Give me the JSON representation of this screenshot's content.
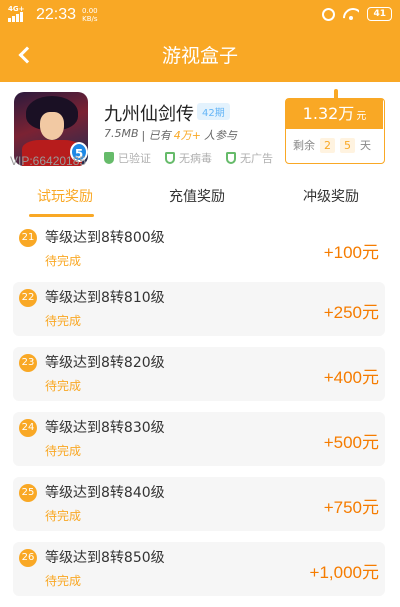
{
  "status_bar": {
    "network": "4G+",
    "time": "22:33",
    "speed_value": "0.00",
    "speed_unit": "KB/s",
    "battery": "41"
  },
  "nav": {
    "title": "游视盒子"
  },
  "game": {
    "name": "九州仙剑传",
    "period": "42期",
    "size": "7.5MB",
    "meta_sep": "| 已有",
    "players": "4万+",
    "players_suffix": "人参与",
    "vip": "VIP:66420185",
    "icon_badge": "5",
    "badges": [
      "已验证",
      "无病毒",
      "无广告"
    ]
  },
  "reward": {
    "amount": "1.32万",
    "unit": "元",
    "remain_label": "剩余",
    "days_tens": "2",
    "days_ones": "5",
    "days_unit": "天"
  },
  "tabs": [
    "试玩奖励",
    "充值奖励",
    "冲级奖励"
  ],
  "tasks": [
    {
      "num": "21",
      "title": "等级达到8转800级",
      "status": "待完成",
      "reward": "+100元"
    },
    {
      "num": "22",
      "title": "等级达到8转810级",
      "status": "待完成",
      "reward": "+250元"
    },
    {
      "num": "23",
      "title": "等级达到8转820级",
      "status": "待完成",
      "reward": "+400元"
    },
    {
      "num": "24",
      "title": "等级达到8转830级",
      "status": "待完成",
      "reward": "+500元"
    },
    {
      "num": "25",
      "title": "等级达到8转840级",
      "status": "待完成",
      "reward": "+750元"
    },
    {
      "num": "26",
      "title": "等级达到8转850级",
      "status": "待完成",
      "reward": "+1,000元"
    }
  ],
  "colors": {
    "primary": "#f9a825",
    "reward_text": "#f57c00",
    "verified_green": "#66bb6a"
  },
  "icons": [
    "back-arrow-icon",
    "alarm-icon",
    "wifi-icon",
    "battery-icon",
    "signal-icon",
    "shield-check-icon"
  ]
}
